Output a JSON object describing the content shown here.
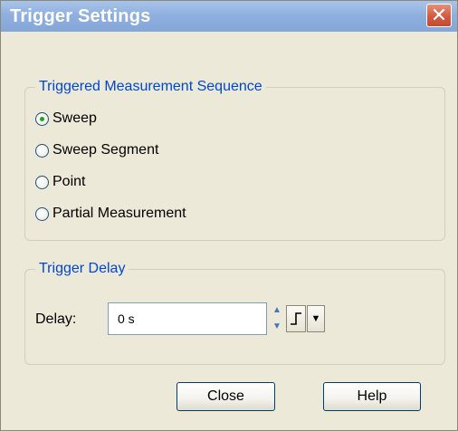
{
  "window": {
    "title": "Trigger Settings",
    "close_glyph": "✕"
  },
  "sequence_group": {
    "legend": "Triggered Measurement Sequence",
    "options": [
      {
        "label": "Sweep",
        "selected": true
      },
      {
        "label": "Sweep Segment",
        "selected": false
      },
      {
        "label": "Point",
        "selected": false
      },
      {
        "label": "Partial Measurement",
        "selected": false
      }
    ]
  },
  "delay_group": {
    "legend": "Trigger Delay",
    "delay_label": "Delay:",
    "delay_value": "0 s"
  },
  "buttons": {
    "close_label": "Close",
    "help_label": "Help"
  },
  "colors": {
    "title_bar": "#8fb0df",
    "group_legend": "#0046d5",
    "close_button": "#d2593f",
    "dialog_background": "#ece9d8"
  }
}
